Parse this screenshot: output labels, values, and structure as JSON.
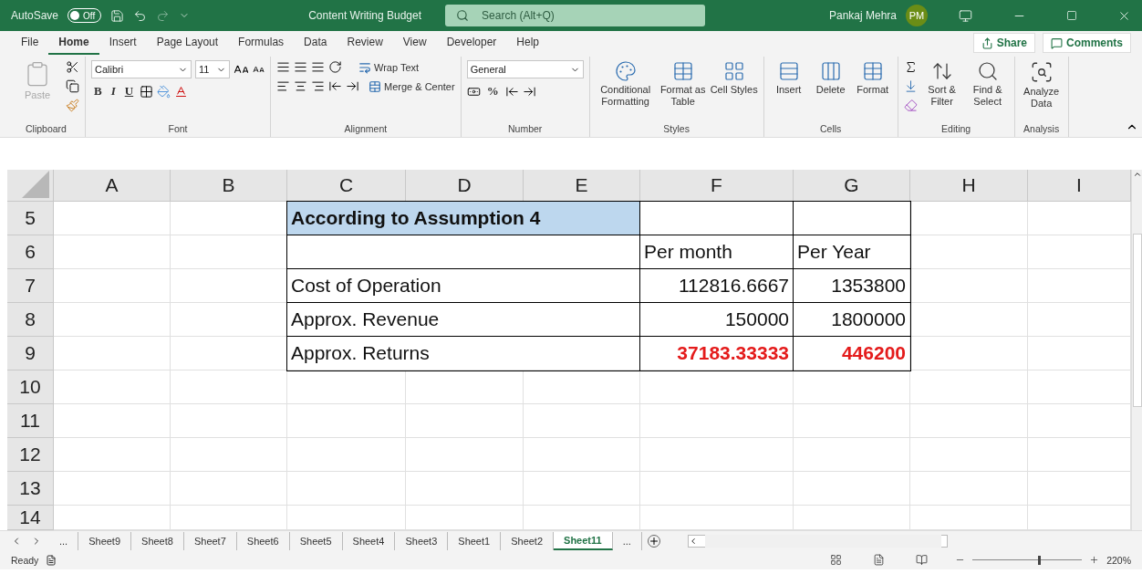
{
  "title_bar": {
    "autosave_label": "AutoSave",
    "autosave_toggle": {
      "label": "Off",
      "on": false
    },
    "document_title": "Content Writing Budget",
    "search": {
      "placeholder": "Search (Alt+Q)"
    },
    "user_name": "Pankaj Mehra",
    "user_initials": "PM"
  },
  "menu_tabs": [
    {
      "label": "File",
      "selected": false
    },
    {
      "label": "Home",
      "selected": true
    },
    {
      "label": "Insert",
      "selected": false
    },
    {
      "label": "Page Layout",
      "selected": false
    },
    {
      "label": "Formulas",
      "selected": false
    },
    {
      "label": "Data",
      "selected": false
    },
    {
      "label": "Review",
      "selected": false
    },
    {
      "label": "View",
      "selected": false
    },
    {
      "label": "Developer",
      "selected": false
    },
    {
      "label": "Help",
      "selected": false
    }
  ],
  "share_button": "Share",
  "comments_button": "Comments",
  "ribbon": {
    "clipboard": {
      "paste": {
        "label": "Paste",
        "disabled": true
      },
      "label": "Clipboard"
    },
    "font": {
      "name": "Calibri",
      "size": "11",
      "style_buttons": [
        "B",
        "I",
        "U"
      ],
      "label": "Font"
    },
    "alignment": {
      "wrap_text": "Wrap Text",
      "merge_center": "Merge & Center",
      "label": "Alignment"
    },
    "number": {
      "format": "General",
      "percent": "%",
      "label": "Number"
    },
    "styles": {
      "buttons": [
        "Conditional Formatting",
        "Format as Table",
        "Cell Styles"
      ],
      "label": "Styles"
    },
    "cells": {
      "buttons": [
        "Insert",
        "Delete",
        "Format"
      ],
      "label": "Cells"
    },
    "editing": {
      "buttons": [
        "Sort & Filter",
        "Find & Select"
      ],
      "label": "Editing"
    },
    "analysis": {
      "buttons": [
        "Analyze Data"
      ],
      "label": "Analysis"
    }
  },
  "sheet": {
    "columns": [
      "A",
      "B",
      "C",
      "D",
      "E",
      "F",
      "G",
      "H",
      "I"
    ],
    "rows": [
      {
        "number": "5",
        "kind": "title",
        "cells": [
          "",
          "",
          "According to Assumption 4",
          "",
          "",
          "",
          "",
          "",
          ""
        ]
      },
      {
        "number": "6",
        "kind": "header",
        "cells": [
          "",
          "",
          "",
          "",
          "",
          "Per month",
          "Per Year",
          "",
          ""
        ]
      },
      {
        "number": "7",
        "kind": "data",
        "cells": [
          "",
          "",
          "Cost of Operation",
          "",
          "",
          "112816.6667",
          "1353800",
          "",
          ""
        ]
      },
      {
        "number": "8",
        "kind": "data",
        "cells": [
          "",
          "",
          "Approx. Revenue",
          "",
          "",
          "150000",
          "1800000",
          "",
          ""
        ]
      },
      {
        "number": "9",
        "kind": "total",
        "cells": [
          "",
          "",
          "Approx. Returns",
          "",
          "",
          "37183.33333",
          "446200",
          "",
          ""
        ]
      },
      {
        "number": "10",
        "kind": "blank"
      },
      {
        "number": "11",
        "kind": "blank"
      },
      {
        "number": "12",
        "kind": "blank"
      },
      {
        "number": "13",
        "kind": "blank"
      },
      {
        "number": "14",
        "kind": "blank"
      }
    ]
  },
  "sheet_tabs": [
    {
      "label": "...",
      "selected": false
    },
    {
      "label": "Sheet9",
      "selected": false
    },
    {
      "label": "Sheet8",
      "selected": false
    },
    {
      "label": "Sheet7",
      "selected": false
    },
    {
      "label": "Sheet6",
      "selected": false
    },
    {
      "label": "Sheet5",
      "selected": false
    },
    {
      "label": "Sheet4",
      "selected": false
    },
    {
      "label": "Sheet3",
      "selected": false
    },
    {
      "label": "Sheet1",
      "selected": false
    },
    {
      "label": "Sheet2",
      "selected": false
    },
    {
      "label": "Sheet11",
      "selected": true
    },
    {
      "label": "...",
      "selected": false
    }
  ],
  "status_bar": {
    "status": "Ready",
    "zoom": "220%",
    "zoom_slider": {
      "level": 0.62
    }
  }
}
